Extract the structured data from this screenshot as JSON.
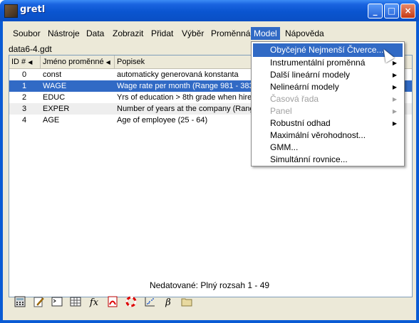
{
  "window": {
    "title": "gretl"
  },
  "menubar": {
    "items": [
      {
        "label": "Soubor"
      },
      {
        "label": "Nástroje"
      },
      {
        "label": "Data"
      },
      {
        "label": "Zobrazit"
      },
      {
        "label": "Přidat"
      },
      {
        "label": "Výběr"
      },
      {
        "label": "Proměnná"
      },
      {
        "label": "Model"
      },
      {
        "label": "Nápověda"
      }
    ]
  },
  "filename": "data6-4.gdt",
  "table": {
    "headers": [
      "ID #",
      "Jméno proměnné",
      "Popisek"
    ],
    "rows": [
      {
        "id": "0",
        "name": "const",
        "label": "automaticky generovaná konstanta"
      },
      {
        "id": "1",
        "name": "WAGE",
        "label": "Wage rate per month (Range 981 - 383"
      },
      {
        "id": "2",
        "name": "EDUC",
        "label": "Yrs of education > 8th grade when hire"
      },
      {
        "id": "3",
        "name": "EXPER",
        "label": "Number of years at the company (Rang"
      },
      {
        "id": "4",
        "name": "AGE",
        "label": "Age of employee (25 - 64)"
      }
    ]
  },
  "status": "Nedatované: Plný rozsah 1 - 49",
  "model_menu": {
    "items": [
      {
        "label": "Obyčejné Nejmenší Čtverce...",
        "submenu": false,
        "disabled": false
      },
      {
        "label": "Instrumentální proměnná",
        "submenu": true,
        "disabled": false
      },
      {
        "label": "Další lineární modely",
        "submenu": true,
        "disabled": false
      },
      {
        "label": "Nelineární modely",
        "submenu": true,
        "disabled": false
      },
      {
        "label": "Časová řada",
        "submenu": true,
        "disabled": true
      },
      {
        "label": "Panel",
        "submenu": true,
        "disabled": true
      },
      {
        "label": "Robustní odhad",
        "submenu": true,
        "disabled": false
      },
      {
        "label": "Maximální věrohodnost...",
        "submenu": false,
        "disabled": false
      },
      {
        "label": "GMM...",
        "submenu": false,
        "disabled": false
      },
      {
        "label": "Simultánní rovnice...",
        "submenu": false,
        "disabled": false
      }
    ]
  },
  "toolbar": {
    "icons": [
      "calculator-icon",
      "edit-icon",
      "terminal-icon",
      "grid-icon",
      "fx-icon",
      "pdf-icon",
      "lifebuoy-icon",
      "scatter-icon",
      "beta-icon",
      "folder-icon"
    ],
    "fx_label": "fx",
    "beta_label": "β"
  },
  "colors": {
    "selection": "#316ac5",
    "titlebar": "#0a55d0"
  }
}
